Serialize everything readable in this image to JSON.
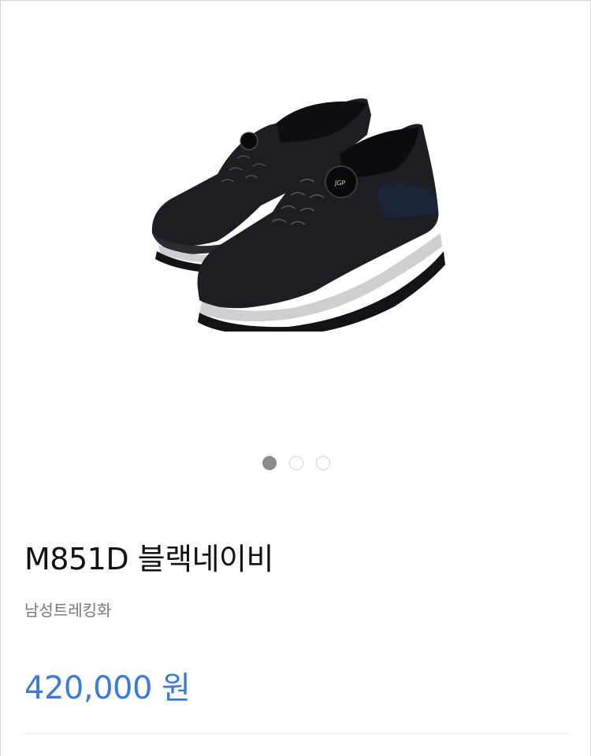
{
  "product": {
    "image_icon": "black-trekking-shoes-image",
    "title": "M851D 블랙네이비",
    "category": "남성트레킹화",
    "price": "420,000 원",
    "price_color": "#3c7ad6"
  },
  "carousel": {
    "slide_count": 3,
    "active_index": 0
  }
}
